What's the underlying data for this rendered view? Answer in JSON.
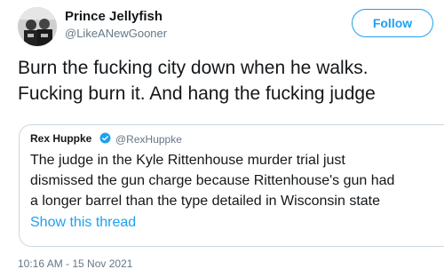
{
  "author": {
    "display_name": "Prince Jellyfish",
    "handle": "@LikeANewGooner",
    "avatar_icon": "avatar-photo"
  },
  "follow_button": {
    "label": "Follow"
  },
  "tweet": {
    "lines": [
      "Burn the fucking city down when he walks.",
      "Fucking burn it. And hang the fucking judge"
    ]
  },
  "quoted_tweet": {
    "display_name": "Rex Huppke",
    "verified_icon": "verified-badge-icon",
    "handle": "@RexHuppke",
    "lines": [
      "The judge in the Kyle Rittenhouse murder trial just",
      "dismissed the gun charge because Rittenhouse's gun had",
      "a longer barrel than the type detailed in Wisconsin state"
    ],
    "show_thread_label": "Show this thread"
  },
  "timestamp": "10:16 AM - 15 Nov 2021",
  "colors": {
    "accent": "#1da1f2",
    "secondary_text": "#657786",
    "border": "#ccd6dd"
  }
}
